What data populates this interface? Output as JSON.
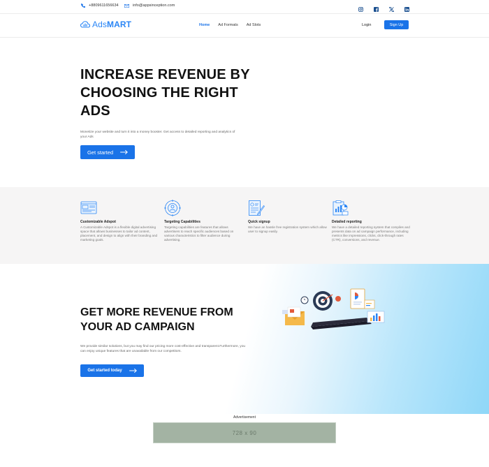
{
  "topbar": {
    "phone": "+8809611656634",
    "email": "info@appsinception.com",
    "social": [
      "instagram-icon",
      "facebook-icon",
      "x-icon",
      "linkedin-icon"
    ]
  },
  "nav": {
    "logo_prefix": "Ads",
    "logo_suffix": "MART",
    "links": [
      "Home",
      "Ad Formats",
      "Ad Slots"
    ],
    "active": "Home",
    "login": "Login",
    "signup": "Sign Up"
  },
  "hero": {
    "title": "INCREASE REVENUE BY CHOOSING THE RIGHT ADS",
    "description": "Monetize your website and turn it into a money booster. Get access to detailed reporting and analytics of your Ads",
    "cta": "Get started"
  },
  "features": [
    {
      "icon": "ad-layout-icon",
      "title": "Customizable Adspot",
      "description": "A Customizable Adspot is a flexible digital advertising space that allows businesses to tailor ad content, placement, and design to align with their branding and marketing goals."
    },
    {
      "icon": "target-icon",
      "title": "Targeting Capabilities",
      "description": "Targeting capabilities are features that allows advertisers to reach specific audiences based on various characteristics to filter audience during advertising."
    },
    {
      "icon": "signup-form-icon",
      "title": "Quick signup",
      "description": "We have an hassle free registration system which allow user to signup easily."
    },
    {
      "icon": "report-icon",
      "title": "Detailed reporting",
      "description": "We have a detailed reporting system that compiles and presents data on ad campaign performance, including metrics like impressions, clicks, click-through rates (CTR), conversions, and revenue."
    }
  ],
  "campaign": {
    "title": "GET MORE REVENUE FROM YOUR AD CAMPAIGN",
    "description": "We provide similar solutions, but you may find our pricing more cost-effective and transparent.Furthermore, you can enjoy unique features that are unavailable from our competitors.",
    "cta": "Get started today"
  },
  "advertisement": {
    "label": "Advertisement",
    "size": "728 x 90"
  },
  "colors": {
    "primary": "#1a73e8",
    "logo": "#2b86f5",
    "band": "#f6f5f5",
    "ad_placeholder": "#a3b3a3"
  }
}
